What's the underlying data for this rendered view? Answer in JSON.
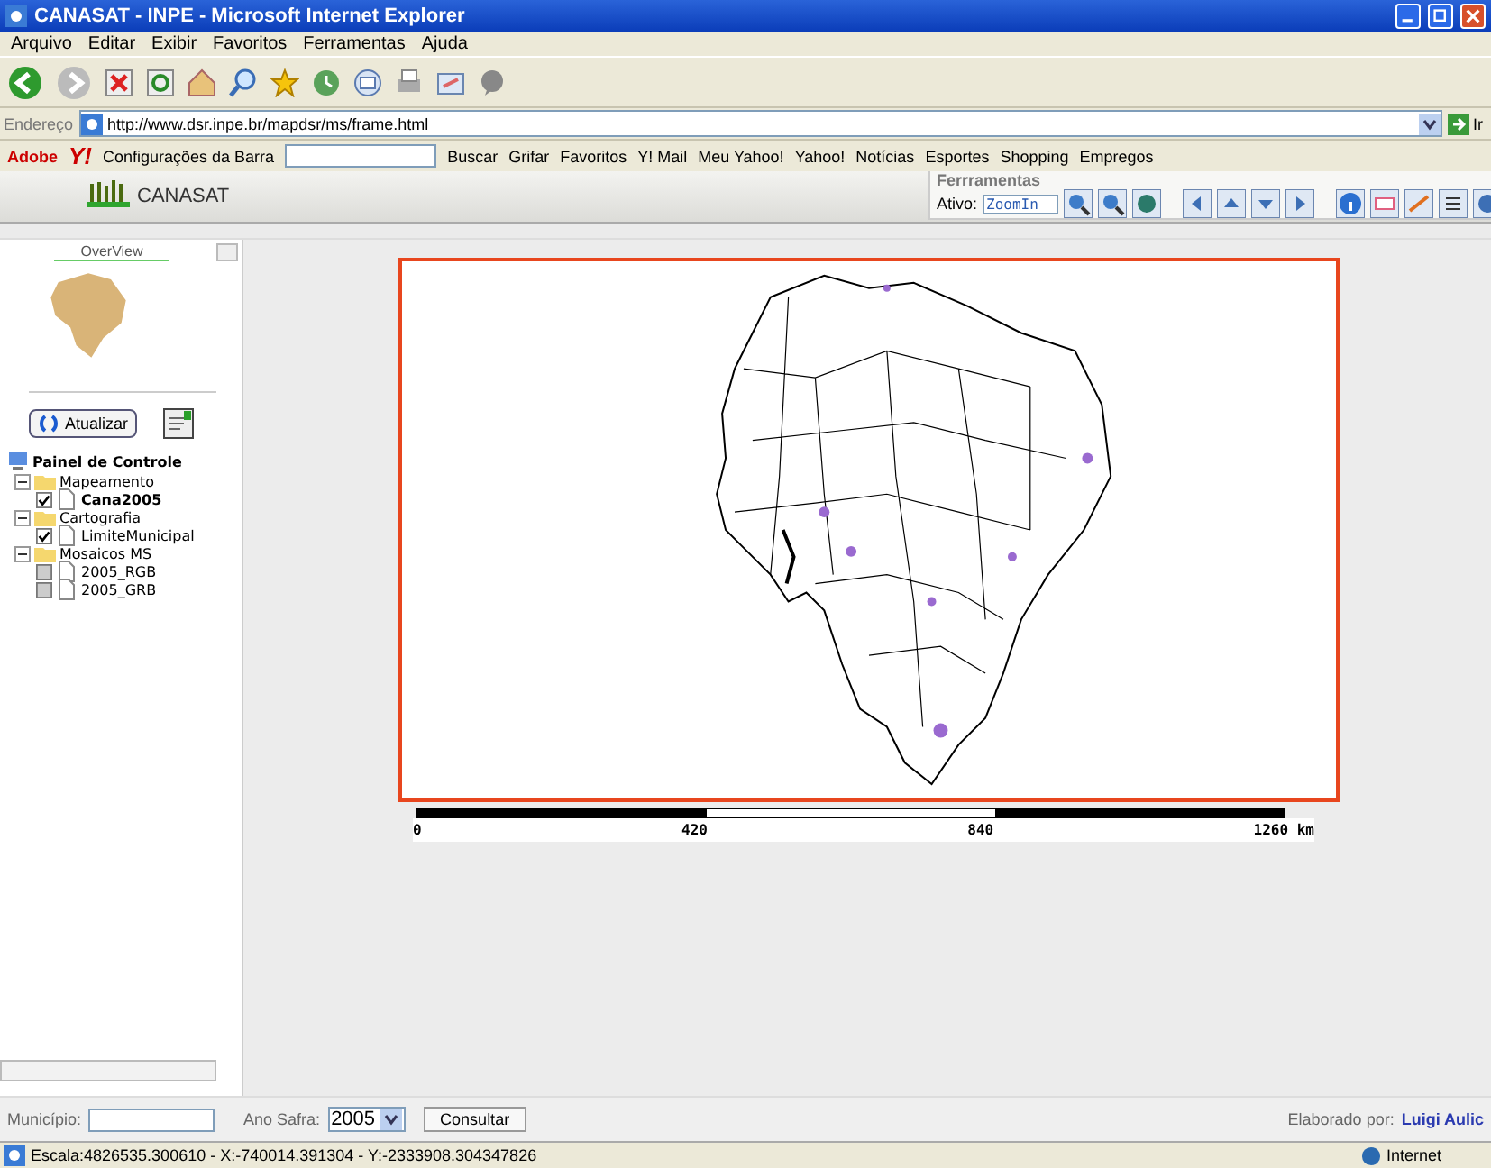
{
  "window": {
    "title": "CANASAT - INPE - Microsoft Internet Explorer"
  },
  "menu": [
    "Arquivo",
    "Editar",
    "Exibir",
    "Favoritos",
    "Ferramentas",
    "Ajuda"
  ],
  "address": {
    "label": "Endereço",
    "url": "http://www.dsr.inpe.br/mapdsr/ms/frame.html",
    "go": "Ir"
  },
  "links_bar": {
    "brand": "Adobe",
    "yahoo": "Y!",
    "settings": "Configurações da Barra",
    "search_button": "Buscar",
    "highlight": "Grifar",
    "links": [
      "Favoritos",
      "Y! Mail",
      "Meu Yahoo!",
      "Yahoo!",
      "Notícias",
      "Esportes",
      "Shopping",
      "Empregos"
    ]
  },
  "app": {
    "logo": "CANASAT",
    "tools": {
      "title": "Ferrramentas",
      "active_label": "Ativo:",
      "active_value": "ZoomIn"
    }
  },
  "sidebar": {
    "overview": "OverView",
    "refresh": "Atualizar",
    "panel": "Painel de Controle",
    "tree": [
      {
        "label": "Mapeamento",
        "expanded": true,
        "children": [
          {
            "label": "Cana2005",
            "checked": true
          }
        ]
      },
      {
        "label": "Cartografia",
        "expanded": true,
        "children": [
          {
            "label": "LimiteMunicipal",
            "checked": true
          }
        ]
      },
      {
        "label": "Mosaicos MS",
        "expanded": true,
        "children": [
          {
            "label": "2005_RGB",
            "checked": false
          },
          {
            "label": "2005_GRB",
            "checked": false
          }
        ]
      }
    ]
  },
  "scale": [
    "0",
    "420",
    "840",
    "1260 km"
  ],
  "form": {
    "municipio_label": "Município:",
    "safra_label": "Ano Safra:",
    "safra_value": "2005",
    "submit": "Consultar",
    "credit_label": "Elaborado por:",
    "credit_name": "Luigi Aulic"
  },
  "status_bar": {
    "text": "Escala:4826535.300610  -  X:-740014.391304  -  Y:-2333908.304347826",
    "zone": "Internet"
  }
}
